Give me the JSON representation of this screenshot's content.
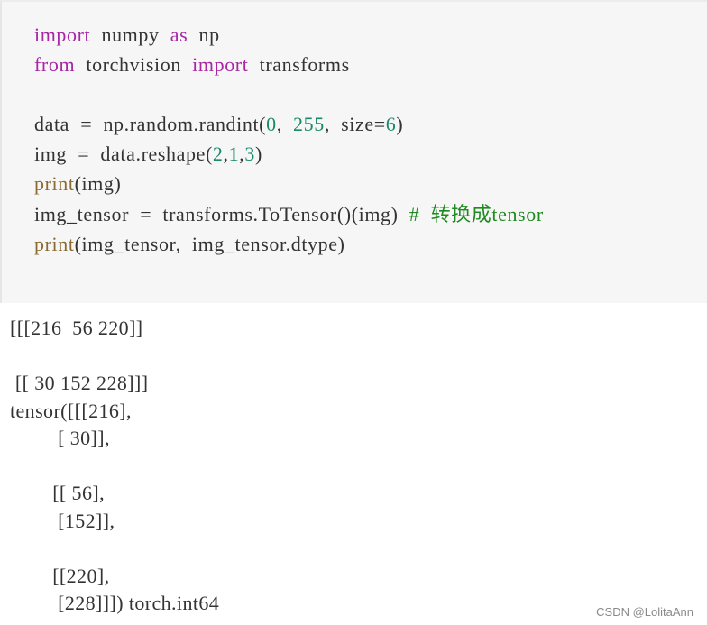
{
  "code": {
    "lines": [
      {
        "tokens": [
          {
            "t": "import",
            "c": "kw"
          },
          {
            "t": "  numpy  ",
            "c": ""
          },
          {
            "t": "as",
            "c": "kw"
          },
          {
            "t": "  np",
            "c": ""
          }
        ]
      },
      {
        "tokens": [
          {
            "t": "from",
            "c": "kw"
          },
          {
            "t": "  torchvision  ",
            "c": ""
          },
          {
            "t": "import",
            "c": "kw"
          },
          {
            "t": "  transforms",
            "c": ""
          }
        ]
      },
      {
        "tokens": []
      },
      {
        "tokens": [
          {
            "t": "data  =  np.random.randint(",
            "c": ""
          },
          {
            "t": "0",
            "c": "num"
          },
          {
            "t": ",  ",
            "c": ""
          },
          {
            "t": "255",
            "c": "num"
          },
          {
            "t": ",  size=",
            "c": ""
          },
          {
            "t": "6",
            "c": "num"
          },
          {
            "t": ")",
            "c": ""
          }
        ]
      },
      {
        "tokens": [
          {
            "t": "img  =  data.reshape(",
            "c": ""
          },
          {
            "t": "2",
            "c": "num"
          },
          {
            "t": ",",
            "c": ""
          },
          {
            "t": "1",
            "c": "num"
          },
          {
            "t": ",",
            "c": ""
          },
          {
            "t": "3",
            "c": "num"
          },
          {
            "t": ")",
            "c": ""
          }
        ]
      },
      {
        "tokens": [
          {
            "t": "print",
            "c": "fn"
          },
          {
            "t": "(img)",
            "c": ""
          }
        ]
      },
      {
        "tokens": [
          {
            "t": "img_tensor  =  transforms.ToTensor()(img)  ",
            "c": ""
          },
          {
            "t": "#  转换成tensor",
            "c": "cm"
          }
        ]
      },
      {
        "tokens": [
          {
            "t": "print",
            "c": "fn"
          },
          {
            "t": "(img_tensor,  img_tensor.dtype)",
            "c": ""
          }
        ]
      }
    ]
  },
  "output": {
    "lines": [
      "[[[216  56 220]]",
      "",
      " [[ 30 152 228]]]",
      "tensor([[[216],",
      "         [ 30]],",
      "",
      "        [[ 56],",
      "         [152]],",
      "",
      "        [[220],",
      "         [228]]]) torch.int64"
    ]
  },
  "watermark": "CSDN @LolitaAnn"
}
